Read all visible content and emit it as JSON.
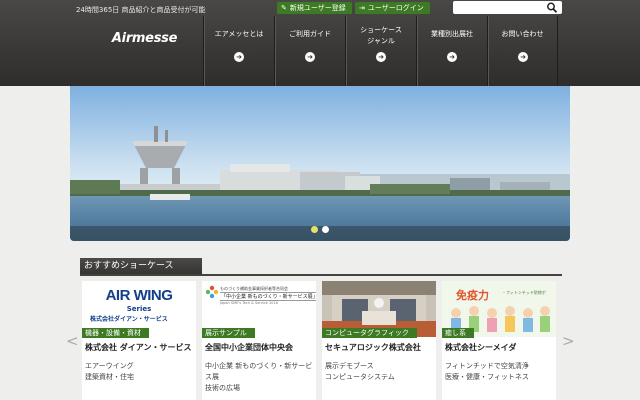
{
  "header": {
    "tagline": "24時間365日 商品紹介と商品受付が可能",
    "register_label": "新規ユーザー登録",
    "login_label": "ユーザーログイン",
    "search_placeholder": "",
    "logo_text": "Airmesse"
  },
  "nav": [
    {
      "label": "エアメッセとは"
    },
    {
      "label": "ご利用ガイド"
    },
    {
      "label": "ショーケース\nジャンル"
    },
    {
      "label": "業種別出展社"
    },
    {
      "label": "お問い合わせ"
    }
  ],
  "slider": {
    "total_slides": 2,
    "active_slide": 1
  },
  "showcase": {
    "title": "おすすめショーケース",
    "cards": [
      {
        "category": "機器・設備・資材",
        "company": "株式会社 ダイアン・サービス",
        "desc": [
          "エアーウイング",
          "建築資材・住宅"
        ],
        "thumb_title": "AIR WING",
        "thumb_series": "Series",
        "thumb_company": "株式会社ダイアン・サービス"
      },
      {
        "category": "展示サンプル",
        "company": "全国中小企業団体中央会",
        "desc": [
          "中小企業 新ものづくり・新サービ",
          "ス展",
          "技術の広場"
        ],
        "thumb_line1": "ものづくり補助金事業採択者等合同会",
        "thumb_line2": "「中小企業 新ものづくり・新サービス展」",
        "thumb_line3": "Japan SME's Tech & Service 2016"
      },
      {
        "category": "コンピュータグラフィック",
        "company": "セキュアロジック株式会社",
        "desc": [
          "展示デモブース",
          "コンピュータシステム"
        ]
      },
      {
        "category": "癒し系",
        "company": "株式会社シーメイダ",
        "desc": [
          "フィトンチッドで空気清浄",
          "医療・健康・フィットネス"
        ],
        "thumb_title": "免疫力",
        "thumb_sub": "・フィトンチッド防除ボ"
      }
    ]
  },
  "colors": {
    "accent_green": "#3c7a24",
    "header_dark": "#3a3836"
  }
}
